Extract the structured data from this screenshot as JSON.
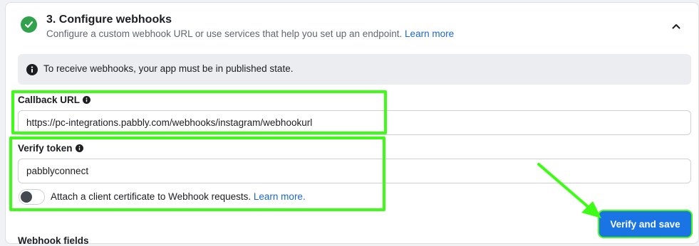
{
  "step": {
    "title": "3. Configure webhooks",
    "description": "Configure a custom webhook URL or use services that help you set up an endpoint. ",
    "learn_more": "Learn more",
    "status_color": "#31a24c"
  },
  "info_banner": {
    "text": "To receive webhooks, your app must be in published state."
  },
  "callback_url": {
    "label": "Callback URL",
    "value": "https://pc-integrations.pabbly.com/webhooks/instagram/webhookurl"
  },
  "verify_token": {
    "label": "Verify token",
    "value": "pabblyconnect"
  },
  "client_certificate": {
    "label": "Attach a client certificate to Webhook requests. ",
    "learn_more": "Learn more.",
    "enabled": false
  },
  "actions": {
    "verify_and_save": "Verify and save"
  },
  "next_section": {
    "heading": "Webhook fields"
  },
  "annotation": {
    "highlight_color": "#3dfc15"
  }
}
